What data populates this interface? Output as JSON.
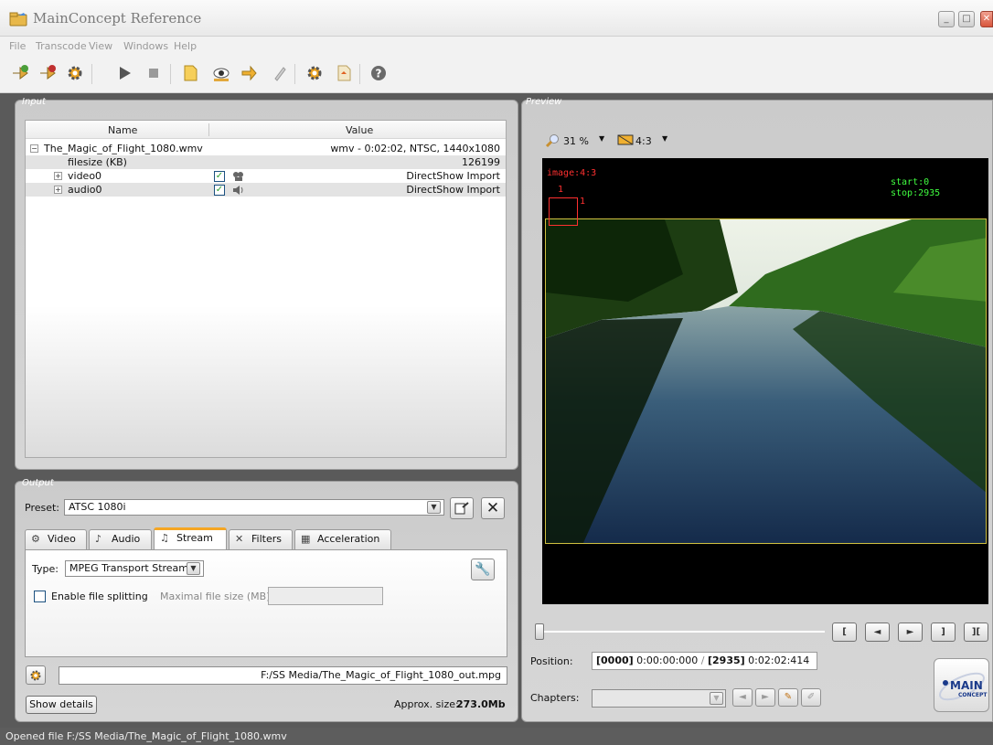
{
  "app": {
    "title": "MainConcept Reference"
  },
  "menu": [
    "File",
    "Transcode",
    "View",
    "Windows",
    "Help"
  ],
  "toolbar": {
    "buttons": [
      "add-input-icon",
      "remove-input-icon",
      "settings-icon",
      "play-icon",
      "stop-icon",
      "new-file-icon",
      "preview-eye-icon",
      "export-icon",
      "edit-pencil-icon",
      "gear-icon",
      "open-icon",
      "help-icon"
    ]
  },
  "input": {
    "title": "Input",
    "columns": {
      "name": "Name",
      "value": "Value"
    },
    "rows": [
      {
        "name": "The_Magic_of_Flight_1080.wmv",
        "value": "wmv - 0:02:02, NTSC, 1440x1080"
      },
      {
        "name": "filesize (KB)",
        "value": "126199"
      },
      {
        "name": "video0",
        "value": "DirectShow Import"
      },
      {
        "name": "audio0",
        "value": "DirectShow Import"
      }
    ]
  },
  "output": {
    "title": "Output",
    "preset_label": "Preset:",
    "preset_value": "ATSC 1080i",
    "tabs": [
      {
        "label": "Video"
      },
      {
        "label": "Audio"
      },
      {
        "label": "Stream"
      },
      {
        "label": "Filters"
      },
      {
        "label": "Acceleration"
      }
    ],
    "active_tab": "Stream",
    "type_label": "Type:",
    "type_value": "MPEG Transport Stream",
    "enable_splitting_label": "Enable file splitting",
    "max_file_size_label": "Maximal file size (MB):",
    "output_path": "F:/SS Media/The_Magic_of_Flight_1080_out.mpg",
    "show_details_label": "Show details",
    "approx_size_label": "Approx. size:",
    "approx_size_value": "273.0Mb"
  },
  "preview": {
    "title": "Preview",
    "zoom": "31 %",
    "aspect": "4:3",
    "overlay_image": "image:4:3",
    "overlay_index": "1",
    "overlay_marker": "1",
    "overlay_start": "start:0",
    "overlay_stop": "stop:2935",
    "nav_buttons": [
      "[",
      "◄",
      "►",
      "]",
      "]["
    ],
    "position_label": "Position:",
    "position_current_frame": "[0000]",
    "position_current_time": "0:00:00:000",
    "position_sep": "/",
    "position_total_frame": "[2935]",
    "position_total_time": "0:02:02:414",
    "chapters_label": "Chapters:",
    "logo_text": "MAIN",
    "logo_sub": "CONCEPT"
  },
  "status": {
    "text": "Opened file F:/SS Media/The_Magic_of_Flight_1080.wmv"
  },
  "colors": {
    "accent": "#f5a623",
    "overlay_red": "#ff3030",
    "overlay_green": "#40ff40"
  }
}
